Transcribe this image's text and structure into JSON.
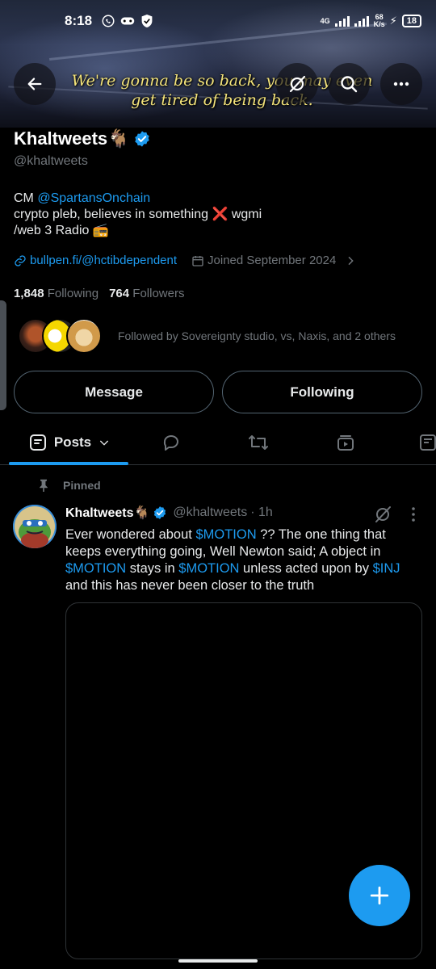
{
  "status_bar": {
    "time": "8:18",
    "network": "4G",
    "speed_value": "68",
    "speed_unit": "K/s",
    "battery": "18"
  },
  "banner": {
    "caption_line1": "We're gonna be so back, you may even",
    "caption_line2": "get tired of being back."
  },
  "profile": {
    "name": "Khaltweets🐐",
    "handle": "@khaltweets",
    "bio_prefix": "CM ",
    "bio_mention": "@SpartansOnchain",
    "bio_line2": "crypto pleb, believes in something ❌ wgmi",
    "bio_line3": "/web 3 Radio 📻",
    "website": "bullpen.fi/@hctibdependent",
    "joined": "Joined September 2024",
    "following_count": "1,848",
    "following_label": "Following",
    "followers_count": "764",
    "followers_label": "Followers",
    "followed_by": "Followed by Sovereignty studio, vs, Naxis, and 2 others"
  },
  "actions": {
    "message_label": "Message",
    "following_label": "Following"
  },
  "tabs": {
    "posts_label": "Posts"
  },
  "tweet": {
    "pinned_label": "Pinned",
    "author_name": "Khaltweets🐐",
    "author_handle": "@khaltweets",
    "time": "· 1h",
    "line1_a": "Ever wondered about ",
    "line1_tag": "$MOTION",
    "line1_b": " ?? The one thing that",
    "line2": "keeps everything going, Well Newton said; A object in",
    "line3_tag1": "$MOTION",
    "line3_a": " stays in ",
    "line3_tag2": "$MOTION",
    "line3_b": " unless acted upon by ",
    "line3_tag3": "$INJ",
    "line4": "and this has never been closer to the truth"
  },
  "colors": {
    "accent": "#1d9bf0",
    "background": "#000000",
    "muted": "#71767b",
    "caption": "#f3e37a"
  },
  "icons": [
    "back-arrow-icon",
    "grok-icon",
    "search-icon",
    "more-icon",
    "verified-icon",
    "link-icon",
    "calendar-icon",
    "chevron-right-icon",
    "pin-icon",
    "chevron-down-icon",
    "reply-icon",
    "repost-icon",
    "media-icon",
    "compose-icon",
    "plus-icon"
  ]
}
